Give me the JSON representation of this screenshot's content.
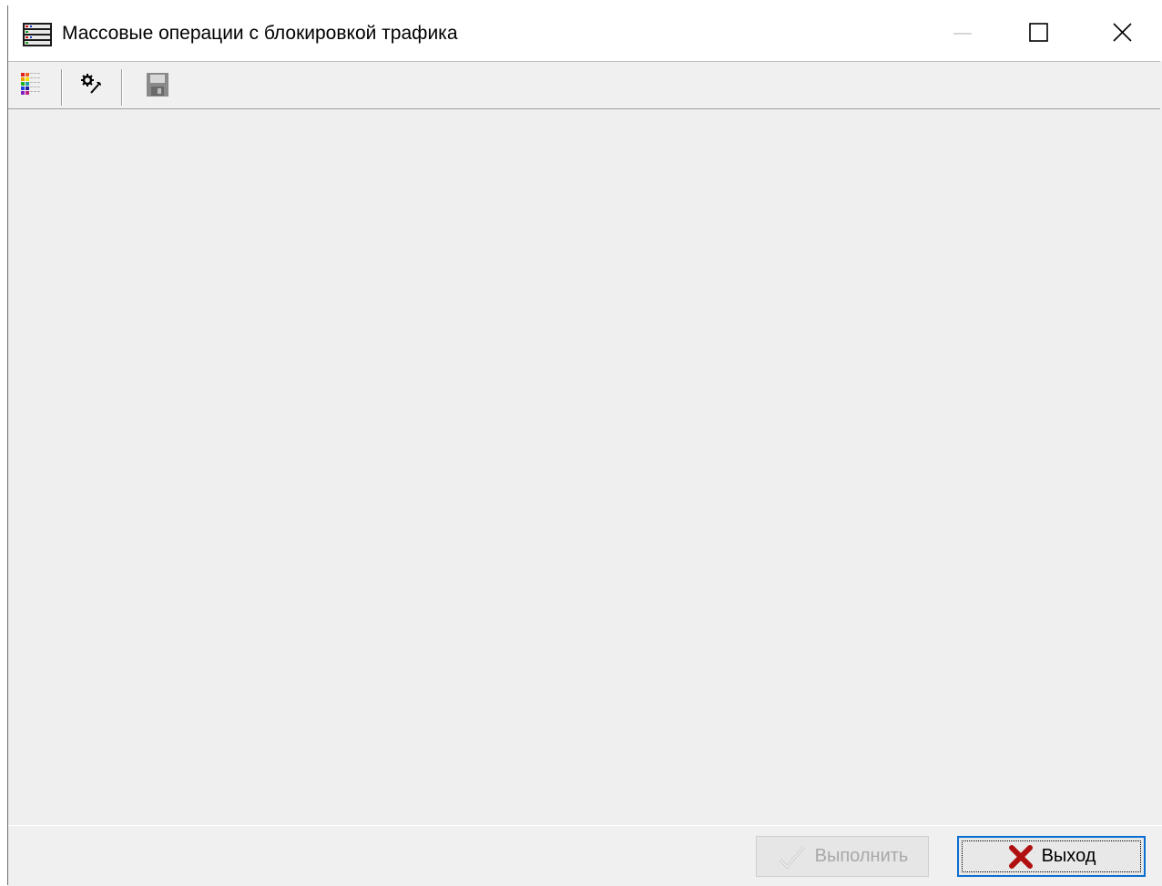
{
  "window": {
    "title": "Массовые операции с блокировкой трафика",
    "title_icon": "server-list-icon",
    "controls": {
      "minimize_icon": "minimize-icon",
      "maximize_icon": "maximize-icon",
      "close_icon": "close-icon"
    }
  },
  "toolbar": {
    "items": [
      {
        "icon": "color-grid-icon"
      },
      {
        "icon": "settings-tools-icon"
      },
      {
        "icon": "save-floppy-icon",
        "disabled": true
      }
    ]
  },
  "footer": {
    "run_label": "Выполнить",
    "run_icon": "checkmark-icon",
    "run_disabled": true,
    "exit_label": "Выход",
    "exit_icon": "red-x-icon"
  },
  "colors": {
    "focus_border": "#0a6fd0",
    "exit_icon": "#b01010",
    "disabled_text": "#a8a8a8"
  }
}
